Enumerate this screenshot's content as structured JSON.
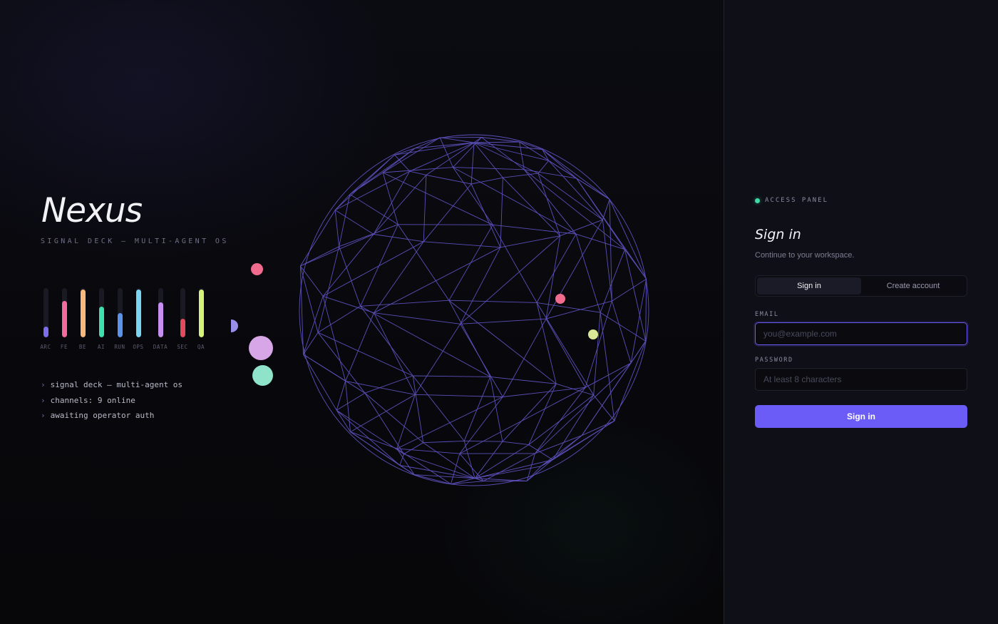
{
  "brand": {
    "name": "Nexus",
    "tagline": "SIGNAL DECK — MULTI-AGENT OS"
  },
  "meters": [
    {
      "label": "ARC",
      "level": 0.22,
      "color": "#7b6ee8"
    },
    {
      "label": "FE",
      "level": 0.74,
      "color": "#f26b9b"
    },
    {
      "label": "BE",
      "level": 0.97,
      "color": "#f6b979"
    },
    {
      "label": "AI",
      "level": 0.63,
      "color": "#3fe0ab"
    },
    {
      "label": "RUN",
      "level": 0.5,
      "color": "#5a93e8"
    },
    {
      "label": "OPS",
      "level": 0.97,
      "color": "#79d6f2"
    },
    {
      "label": "DATA",
      "level": 0.71,
      "color": "#c68ff0"
    },
    {
      "label": "SEC",
      "level": 0.38,
      "color": "#e24b5e"
    },
    {
      "label": "QA",
      "level": 0.97,
      "color": "#d6f27a"
    }
  ],
  "console": {
    "prompt": "›",
    "lines": [
      "signal deck — multi-agent os",
      "channels: 9 online",
      "awaiting operator auth"
    ]
  },
  "colors": {
    "accent": "#6c5cf7",
    "status_online": "#3ddca4",
    "wireframe": "#5a4fb8",
    "node_pink": "#f06b8e",
    "node_lime": "#d8e896",
    "bubble_pink": "#f06b8e",
    "bubble_violet": "#9a8fe8",
    "bubble_lilac": "#d7a6e6",
    "bubble_mint": "#8fe3c8"
  },
  "panel": {
    "status": "ACCESS PANEL",
    "title": "Sign in",
    "subtitle": "Continue to your workspace.",
    "tabs": [
      {
        "label": "Sign in",
        "active": true
      },
      {
        "label": "Create account",
        "active": false
      }
    ],
    "email": {
      "label": "EMAIL",
      "value": "",
      "placeholder": "you@example.com"
    },
    "password": {
      "label": "PASSWORD",
      "value": "",
      "placeholder": "At least 8 characters"
    },
    "submit_label": "Sign in"
  }
}
